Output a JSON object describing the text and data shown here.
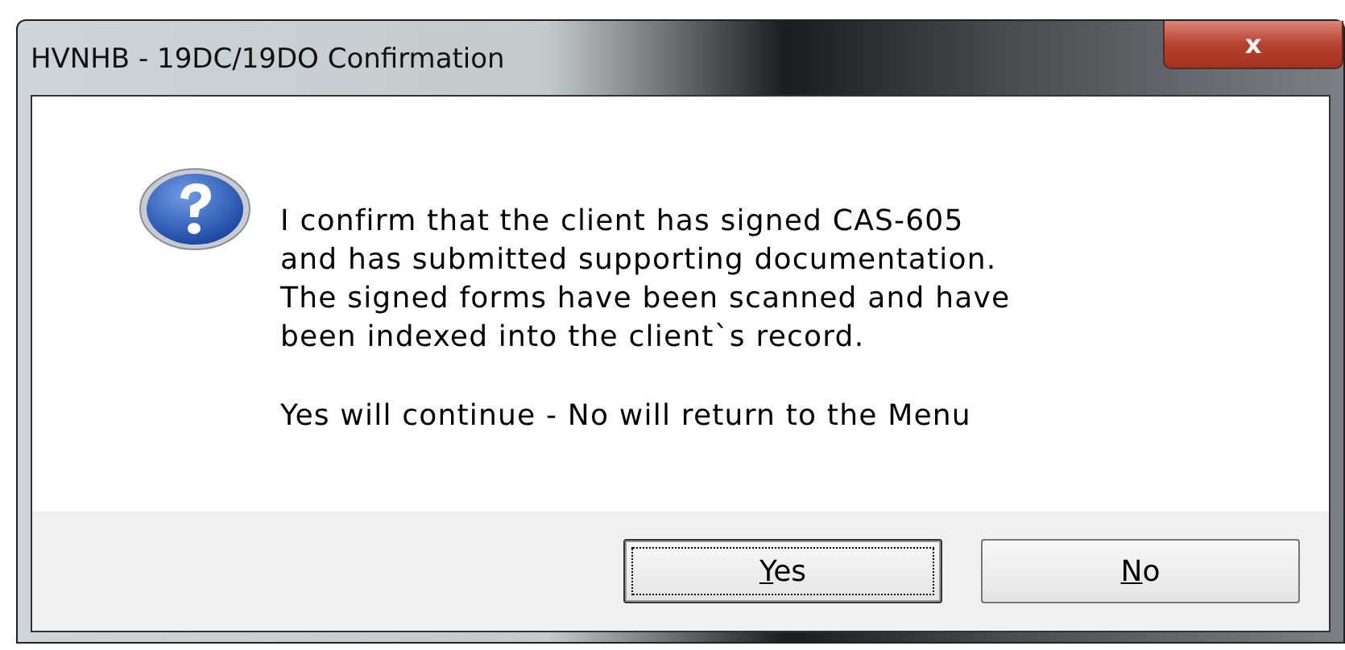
{
  "window": {
    "title": "HVNHB - 19DC/19DO Confirmation",
    "close_glyph": "x"
  },
  "message": {
    "body": "I confirm that the client has signed CAS-605\nand has submitted supporting documentation.\nThe signed forms have been scanned and have\nbeen indexed into the client`s record.",
    "hint": "Yes will continue - No will return to the Menu"
  },
  "buttons": [
    {
      "mnemonic": "Y",
      "rest": "es",
      "focused": true
    },
    {
      "mnemonic": "N",
      "rest": "o",
      "focused": false
    }
  ]
}
